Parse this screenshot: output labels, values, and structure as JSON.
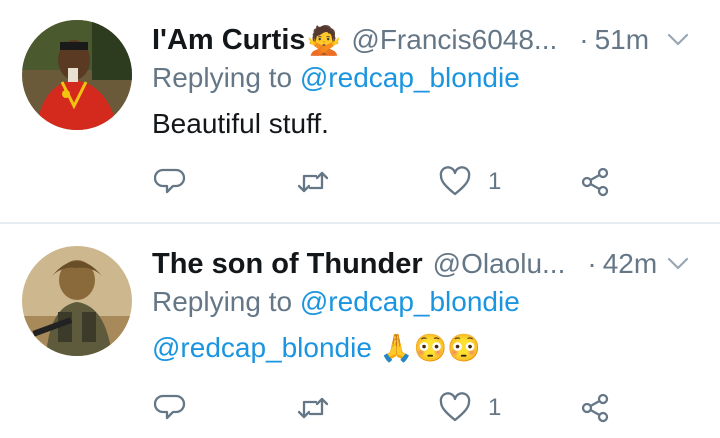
{
  "tweets": [
    {
      "name": "I'Am Curtis",
      "name_emoji": "🙅",
      "handle": "@Francis6048...",
      "dot": "·",
      "time": "51m",
      "replying_prefix": "Replying to",
      "replying_to": "@redcap_blondie",
      "text": "Beautiful stuff.",
      "like_count": "1",
      "icons": [
        "reply-icon",
        "retweet-icon",
        "like-icon",
        "share-icon",
        "chevron-down-icon"
      ]
    },
    {
      "name": "The son of Thunder",
      "handle": "@Olaolu...",
      "dot": "·",
      "time": "42m",
      "replying_prefix": "Replying to",
      "replying_to": "@redcap_blondie",
      "text_mention": "@redcap_blondie",
      "text_emojis": "🙏😳😳",
      "like_count": "1",
      "icons": [
        "reply-icon",
        "retweet-icon",
        "like-icon",
        "share-icon",
        "chevron-down-icon"
      ]
    }
  ],
  "colors": {
    "text": "#14171a",
    "secondary": "#657786",
    "link": "#1b95e0",
    "divider": "#e6ecf0"
  }
}
